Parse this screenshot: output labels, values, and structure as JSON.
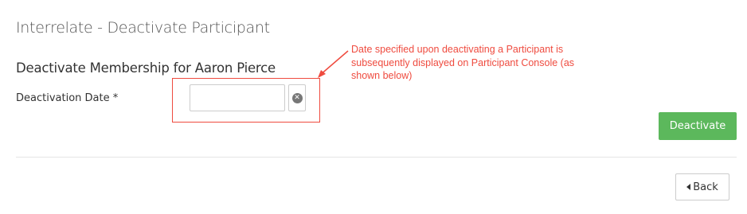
{
  "page": {
    "title": "Interrelate - Deactivate Participant"
  },
  "form": {
    "section_title": "Deactivate Membership for Aaron Pierce",
    "date_label": "Deactivation Date *",
    "date_value": "",
    "date_placeholder": "",
    "clear_icon": "times-circle-icon"
  },
  "annotation": {
    "text": "Date specified upon deactivating a Participant is subsequently displayed on Participant Console (as shown below)",
    "color": "#ef4b3f"
  },
  "actions": {
    "deactivate_label": "Deactivate",
    "deactivate_color": "#5cb85c",
    "back_label": "Back",
    "back_icon": "caret-left-icon"
  }
}
